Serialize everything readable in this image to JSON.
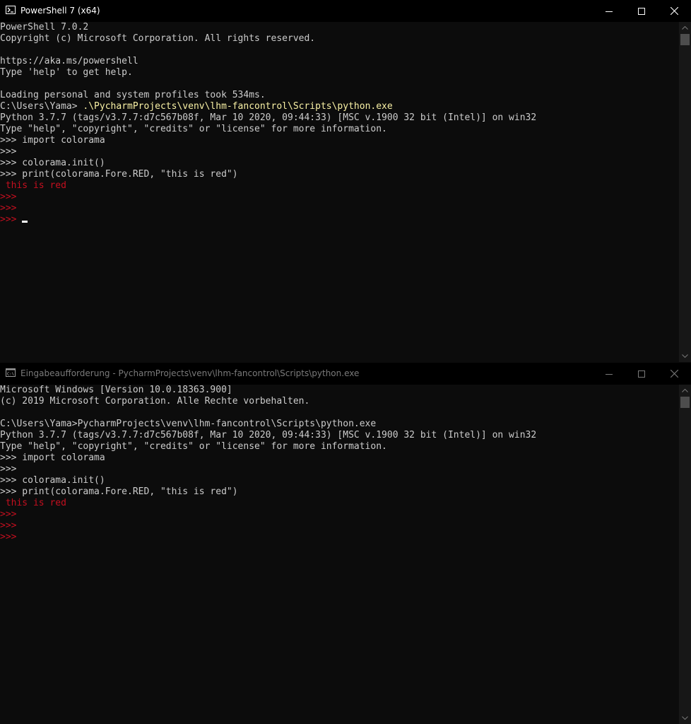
{
  "windows": [
    {
      "title": "PowerShell 7 (x64)",
      "icon": "powershell-icon",
      "lines": [
        {
          "segments": [
            {
              "text": "PowerShell 7.0.2",
              "color": "#cccccc"
            }
          ]
        },
        {
          "segments": [
            {
              "text": "Copyright (c) Microsoft Corporation. All rights reserved.",
              "color": "#cccccc"
            }
          ]
        },
        {
          "segments": [
            {
              "text": "",
              "color": "#cccccc"
            }
          ]
        },
        {
          "segments": [
            {
              "text": "https://aka.ms/powershell",
              "color": "#cccccc"
            }
          ]
        },
        {
          "segments": [
            {
              "text": "Type 'help' to get help.",
              "color": "#cccccc"
            }
          ]
        },
        {
          "segments": [
            {
              "text": "",
              "color": "#cccccc"
            }
          ]
        },
        {
          "segments": [
            {
              "text": "Loading personal and system profiles took 534ms.",
              "color": "#cccccc"
            }
          ]
        },
        {
          "segments": [
            {
              "text": "C:\\Users\\Yama> ",
              "color": "#cccccc"
            },
            {
              "text": ".\\PycharmProjects\\venv\\lhm-fancontrol\\Scripts\\python.exe",
              "color": "#f9f1a5"
            }
          ]
        },
        {
          "segments": [
            {
              "text": "Python 3.7.7 (tags/v3.7.7:d7c567b08f, Mar 10 2020, 09:44:33) [MSC v.1900 32 bit (Intel)] on win32",
              "color": "#cccccc"
            }
          ]
        },
        {
          "segments": [
            {
              "text": "Type \"help\", \"copyright\", \"credits\" or \"license\" for more information.",
              "color": "#cccccc"
            }
          ]
        },
        {
          "segments": [
            {
              "text": ">>> import colorama",
              "color": "#cccccc"
            }
          ]
        },
        {
          "segments": [
            {
              "text": ">>>",
              "color": "#cccccc"
            }
          ]
        },
        {
          "segments": [
            {
              "text": ">>> colorama.init()",
              "color": "#cccccc"
            }
          ]
        },
        {
          "segments": [
            {
              "text": ">>> print(colorama.Fore.RED, \"this is red\")",
              "color": "#cccccc"
            }
          ]
        },
        {
          "segments": [
            {
              "text": " this is red",
              "color": "#c50f1f"
            }
          ]
        },
        {
          "segments": [
            {
              "text": ">>>",
              "color": "#c50f1f"
            }
          ]
        },
        {
          "segments": [
            {
              "text": ">>>",
              "color": "#c50f1f"
            }
          ]
        },
        {
          "segments": [
            {
              "text": ">>> ",
              "color": "#c50f1f"
            }
          ],
          "cursor": true
        }
      ]
    },
    {
      "title": "Eingabeaufforderung - PycharmProjects\\venv\\lhm-fancontrol\\Scripts\\python.exe",
      "icon": "cmd-icon",
      "lines": [
        {
          "segments": [
            {
              "text": "Microsoft Windows [Version 10.0.18363.900]",
              "color": "#cccccc"
            }
          ]
        },
        {
          "segments": [
            {
              "text": "(c) 2019 Microsoft Corporation. Alle Rechte vorbehalten.",
              "color": "#cccccc"
            }
          ]
        },
        {
          "segments": [
            {
              "text": "",
              "color": "#cccccc"
            }
          ]
        },
        {
          "segments": [
            {
              "text": "C:\\Users\\Yama>PycharmProjects\\venv\\lhm-fancontrol\\Scripts\\python.exe",
              "color": "#cccccc"
            }
          ]
        },
        {
          "segments": [
            {
              "text": "Python 3.7.7 (tags/v3.7.7:d7c567b08f, Mar 10 2020, 09:44:33) [MSC v.1900 32 bit (Intel)] on win32",
              "color": "#cccccc"
            }
          ]
        },
        {
          "segments": [
            {
              "text": "Type \"help\", \"copyright\", \"credits\" or \"license\" for more information.",
              "color": "#cccccc"
            }
          ]
        },
        {
          "segments": [
            {
              "text": ">>> import colorama",
              "color": "#cccccc"
            }
          ]
        },
        {
          "segments": [
            {
              "text": ">>>",
              "color": "#cccccc"
            }
          ]
        },
        {
          "segments": [
            {
              "text": ">>> colorama.init()",
              "color": "#cccccc"
            }
          ]
        },
        {
          "segments": [
            {
              "text": ">>> print(colorama.Fore.RED, \"this is red\")",
              "color": "#cccccc"
            }
          ]
        },
        {
          "segments": [
            {
              "text": " this is red",
              "color": "#c50f1f"
            }
          ]
        },
        {
          "segments": [
            {
              "text": ">>>",
              "color": "#c50f1f"
            }
          ]
        },
        {
          "segments": [
            {
              "text": ">>>",
              "color": "#c50f1f"
            }
          ]
        },
        {
          "segments": [
            {
              "text": ">>>",
              "color": "#c50f1f"
            }
          ]
        }
      ]
    }
  ],
  "colors": {
    "background": "#0c0c0c",
    "foreground": "#cccccc",
    "red": "#c50f1f",
    "yellow": "#f9f1a5",
    "titlebar_active": "#000000"
  }
}
